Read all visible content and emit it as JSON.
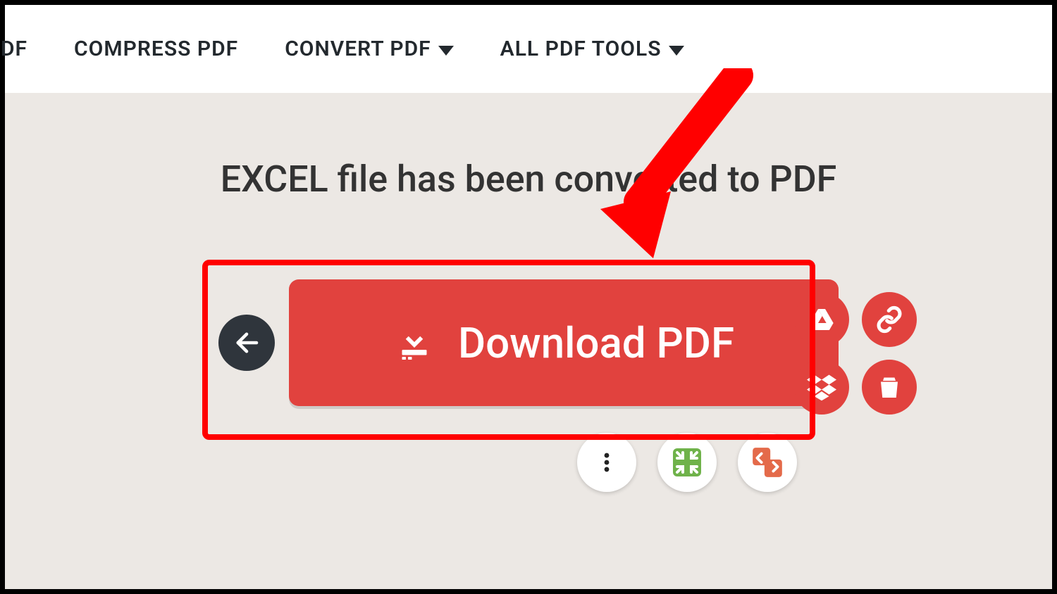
{
  "nav": {
    "item0_partial": "DF",
    "item1": "COMPRESS PDF",
    "item2": "CONVERT PDF",
    "item3": "ALL PDF TOOLS"
  },
  "stage": {
    "title": "EXCEL file has been converted to PDF",
    "download_label": "Download PDF"
  },
  "icons": {
    "back": "back-arrow",
    "download": "download",
    "gdrive": "google-drive",
    "link": "link",
    "dropbox": "dropbox",
    "delete": "trash",
    "more": "more-vertical",
    "compress": "compress",
    "merge": "merge-pdf"
  },
  "colors": {
    "accent": "#e1423e",
    "bg": "#ece8e4",
    "dark": "#2f353c"
  }
}
